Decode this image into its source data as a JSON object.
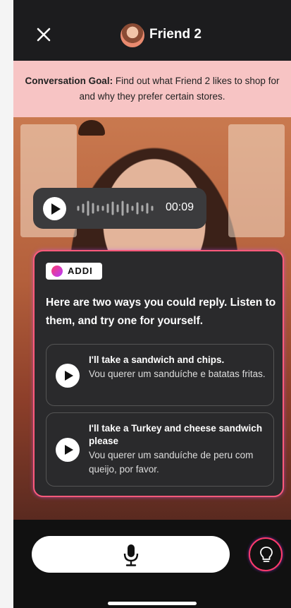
{
  "header": {
    "title": "Friend 2",
    "close_icon": "close-icon",
    "avatar_icon": "avatar"
  },
  "goal": {
    "label": "Conversation Goal:",
    "text": " Find out what Friend 2 likes to shop for and why they prefer certain stores."
  },
  "audio": {
    "duration": "00:09",
    "icon": "play-icon"
  },
  "card": {
    "badge": "ADDI",
    "intro": "Here are two ways you could reply. Listen to them, and try one for yourself.",
    "options": [
      {
        "en": "I'll take a sandwich and chips.",
        "pt": "Vou querer um sanduíche e batatas fritas."
      },
      {
        "en": "I'll take a Turkey and cheese sandwich please",
        "pt": "Vou querer um sanduíche de peru com queijo, por favor."
      }
    ]
  },
  "footer": {
    "mic_icon": "microphone-icon",
    "hint_icon": "lightbulb-icon"
  },
  "colors": {
    "accent": "#ff3b6b",
    "goal_bg": "#f7c4c4",
    "dark": "#1c1c1e"
  }
}
